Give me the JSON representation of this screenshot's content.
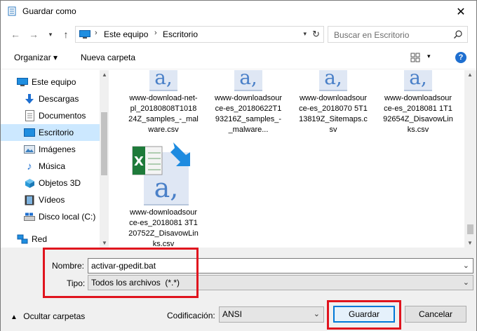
{
  "window": {
    "title": "Guardar como"
  },
  "nav": {
    "path": [
      "Este equipo",
      "Escritorio"
    ],
    "search_placeholder": "Buscar en Escritorio"
  },
  "toolbar": {
    "organize": "Organizar ▾",
    "new_folder": "Nueva carpeta",
    "help": "?"
  },
  "sidebar": {
    "items": [
      {
        "label": "Este equipo",
        "icon": "computer-icon"
      },
      {
        "label": "Descargas",
        "icon": "download-icon"
      },
      {
        "label": "Documentos",
        "icon": "documents-icon"
      },
      {
        "label": "Escritorio",
        "icon": "desktop-icon",
        "selected": true
      },
      {
        "label": "Imágenes",
        "icon": "pictures-icon"
      },
      {
        "label": "Música",
        "icon": "music-icon"
      },
      {
        "label": "Objetos 3D",
        "icon": "objects3d-icon"
      },
      {
        "label": "Vídeos",
        "icon": "videos-icon"
      },
      {
        "label": "Disco local (C:)",
        "icon": "drive-icon"
      },
      {
        "label": "Red",
        "icon": "network-icon"
      }
    ]
  },
  "files": [
    {
      "name": "www-download-net-pl_20180808T101824Z_samples_-_malware.csv"
    },
    {
      "name": "www-downloadsource-es_20180622T193216Z_samples_-_malware..."
    },
    {
      "name": "www-downloadsource-es_2018070 5T113819Z_Sitemaps.csv"
    },
    {
      "name": "www-downloadsource-es_2018081 1T192654Z_DisavowLinks.csv"
    },
    {
      "name": "www-downloadsource-es_2018081 3T120752Z_DisavowLinks.csv"
    }
  ],
  "form": {
    "filename_label": "Nombre:",
    "filename_value": "activar-gpedit.bat",
    "type_label": "Tipo:",
    "type_value": "Todos los archivos  (*.*)",
    "encoding_label": "Codificación:",
    "encoding_value": "ANSI",
    "hide_folders": "Ocultar carpetas",
    "save": "Guardar",
    "cancel": "Cancelar"
  },
  "colors": {
    "highlight": "#e0141e",
    "selection": "#cce8ff",
    "accent": "#0078d7"
  }
}
